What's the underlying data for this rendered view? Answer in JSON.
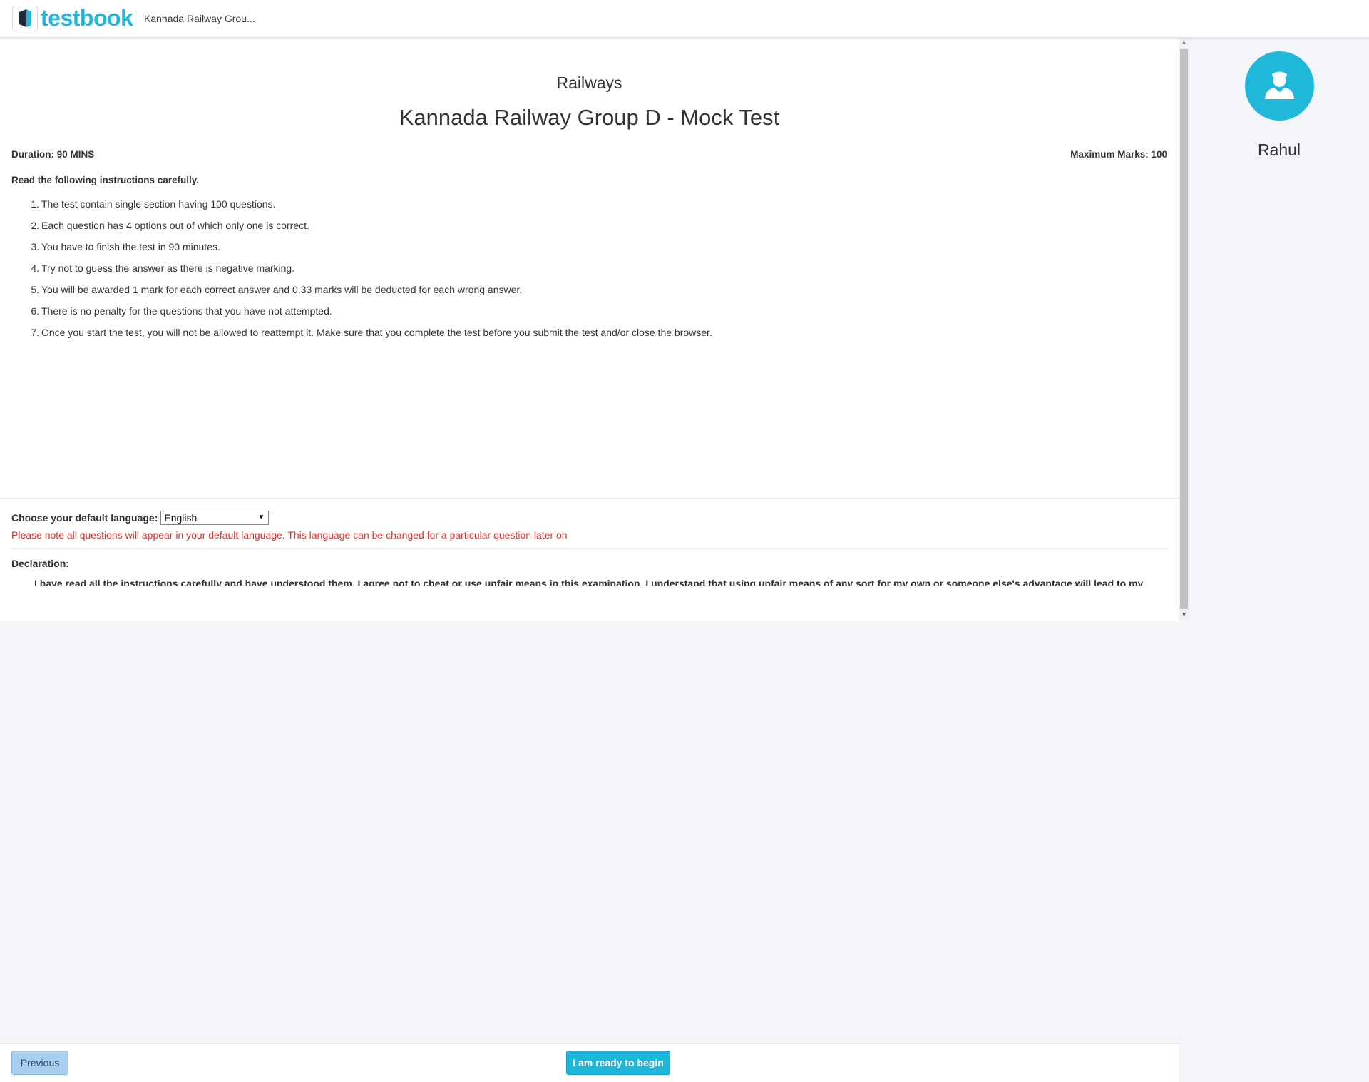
{
  "header": {
    "logo_text": "testbook",
    "test_name_short": "Kannada Railway Grou..."
  },
  "instructions": {
    "category": "Railways",
    "title": "Kannada Railway Group D - Mock Test",
    "duration": "Duration: 90 MINS",
    "max_marks": "Maximum Marks: 100",
    "heading": "Read the following instructions carefully.",
    "items": [
      {
        "num": "1.",
        "text": "The test contain single section having 100 questions."
      },
      {
        "num": "2.",
        "text": "Each question has 4 options out of which only one is correct."
      },
      {
        "num": "3.",
        "text": "You have to finish the test in 90 minutes."
      },
      {
        "num": "4.",
        "text": "Try not to guess the answer as there is negative marking."
      },
      {
        "num": "5.",
        "text": "You will be awarded 1 mark for each correct answer and 0.33 marks will be deducted for each wrong answer."
      },
      {
        "num": "6.",
        "text": "There is no penalty for the questions that you have not attempted."
      },
      {
        "num": "7.",
        "text": "Once you start the test, you will not be allowed to reattempt it. Make sure that you complete the test before you submit the test and/or close the browser."
      }
    ]
  },
  "language": {
    "label": "Choose your default language:",
    "selected": "English",
    "note": "Please note all questions will appear in your default language. This language can be changed for a particular question later on"
  },
  "declaration": {
    "heading": "Declaration:",
    "text": "I have read all the instructions carefully and have understood them. I agree not to cheat or use unfair means in this examination. I understand that using unfair means of any sort for my own or someone else's advantage will lead to my immediate"
  },
  "footer": {
    "previous_label": "Previous",
    "begin_label": "I am ready to begin"
  },
  "user": {
    "name": "Rahul"
  },
  "colors": {
    "brand": "#1fb8dd",
    "warning_text": "#d9322e",
    "begin_button": "#1cb6d8",
    "previous_button": "#a8cfef"
  }
}
